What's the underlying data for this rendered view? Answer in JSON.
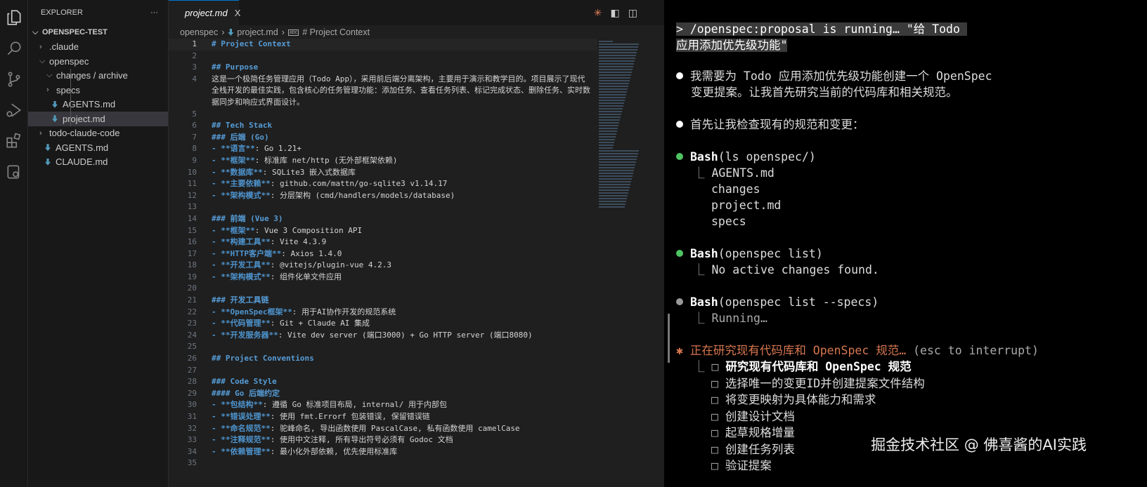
{
  "activity_bar": [
    "explorer-icon",
    "search-icon",
    "source-control-icon",
    "run-debug-icon",
    "extensions-icon",
    "remote-explorer-icon"
  ],
  "sidebar": {
    "title": "EXPLORER",
    "more": "···",
    "root": "OPENSPEC-TEST",
    "items": [
      {
        "label": ".claude",
        "type": "folder",
        "open": false,
        "depth": 1
      },
      {
        "label": "openspec",
        "type": "folder",
        "open": true,
        "depth": 1
      },
      {
        "label": "changes / archive",
        "type": "folder",
        "open": true,
        "depth": 2
      },
      {
        "label": "specs",
        "type": "folder",
        "open": false,
        "depth": 2
      },
      {
        "label": "AGENTS.md",
        "type": "md",
        "depth": 2
      },
      {
        "label": "project.md",
        "type": "md",
        "depth": 2,
        "selected": true
      },
      {
        "label": "todo-claude-code",
        "type": "folder",
        "open": false,
        "depth": 1
      },
      {
        "label": "AGENTS.md",
        "type": "md",
        "depth": 1
      },
      {
        "label": "CLAUDE.md",
        "type": "md",
        "depth": 1
      }
    ]
  },
  "editor": {
    "tab": "project.md",
    "tab_close": "X",
    "breadcrumb": [
      "openspec",
      "project.md",
      "# Project Context"
    ],
    "lines": [
      {
        "n": "1",
        "h": "# Project Context"
      },
      {
        "n": "2"
      },
      {
        "n": "3",
        "h": "## Purpose"
      },
      {
        "n": "4",
        "t": "这是一个极简任务管理应用（Todo App），采用前后端分离架构，主要用于演示和教学目的。项目展示了现代全栈开发的最佳实践，包含核心的任务管理功能：添加任务、查看任务列表、标记完成状态、删除任务、实时数据同步和响应式界面设计。"
      },
      {
        "n": "5"
      },
      {
        "n": "6",
        "h": "## Tech Stack"
      },
      {
        "n": "7",
        "h": "### 后端 (Go)"
      },
      {
        "n": "8",
        "b": "- **语言**",
        "t": ": Go 1.21+"
      },
      {
        "n": "9",
        "b": "- **框架**",
        "t": ": 标准库 net/http (无外部框架依赖)"
      },
      {
        "n": "10",
        "b": "- **数据库**",
        "t": ": SQLite3 嵌入式数据库"
      },
      {
        "n": "11",
        "b": "- **主要依赖**",
        "t": ": github.com/mattn/go-sqlite3 v1.14.17"
      },
      {
        "n": "12",
        "b": "- **架构模式**",
        "t": ": 分层架构 (cmd/handlers/models/database)"
      },
      {
        "n": "13"
      },
      {
        "n": "14",
        "h": "### 前端 (Vue 3)"
      },
      {
        "n": "15",
        "b": "- **框架**",
        "t": ": Vue 3 Composition API"
      },
      {
        "n": "16",
        "b": "- **构建工具**",
        "t": ": Vite 4.3.9"
      },
      {
        "n": "17",
        "b": "- **HTTP客户端**",
        "t": ": Axios 1.4.0"
      },
      {
        "n": "18",
        "b": "- **开发工具**",
        "t": ": @vitejs/plugin-vue 4.2.3"
      },
      {
        "n": "19",
        "b": "- **架构模式**",
        "t": ": 组件化单文件应用"
      },
      {
        "n": "20"
      },
      {
        "n": "21",
        "h": "### 开发工具链"
      },
      {
        "n": "22",
        "b": "- **OpenSpec框架**",
        "t": ": 用于AI协作开发的规范系统"
      },
      {
        "n": "23",
        "b": "- **代码管理**",
        "t": ": Git + Claude AI 集成"
      },
      {
        "n": "24",
        "b": "- **开发服务器**",
        "t": ": Vite dev server (端口3000) + Go HTTP server (端口8080)"
      },
      {
        "n": "25"
      },
      {
        "n": "26",
        "h": "## Project Conventions"
      },
      {
        "n": "27"
      },
      {
        "n": "28",
        "h": "### Code Style"
      },
      {
        "n": "29",
        "h": "#### Go 后端约定"
      },
      {
        "n": "30",
        "b": "- **包结构**",
        "t": ": 遵循 Go 标准项目布局, internal/ 用于内部包"
      },
      {
        "n": "31",
        "b": "- **错误处理**",
        "t": ": 使用 fmt.Errorf 包装错误, 保留错误链"
      },
      {
        "n": "32",
        "b": "- **命名规范**",
        "t": ": 驼峰命名, 导出函数使用 PascalCase, 私有函数使用 camelCase"
      },
      {
        "n": "33",
        "b": "- **注释规范**",
        "t": ": 使用中文注释, 所有导出符号必须有 Godoc 文档"
      },
      {
        "n": "34",
        "b": "- **依赖管理**",
        "t": ": 最小化外部依赖, 优先使用标准库"
      },
      {
        "n": "35"
      }
    ]
  },
  "terminal": {
    "prompt1": "> /openspec:proposal is running… \"给 Todo ",
    "prompt2": "应用添加优先级功能\"",
    "msg1a": "我需要为 Todo 应用添加优先级功能创建一个 OpenSpec",
    "msg1b": "变更提案。让我首先研究当前的代码库和相关规范。",
    "msg2": "首先让我检查现有的规范和变更：",
    "tool1": {
      "name": "Bash",
      "args": "(ls openspec/)",
      "output": [
        "AGENTS.md",
        "changes",
        "project.md",
        "specs"
      ]
    },
    "tool2": {
      "name": "Bash",
      "args": "(openspec list)",
      "output": [
        "No active changes found."
      ]
    },
    "tool3": {
      "name": "Bash",
      "args": "(openspec list --specs)",
      "output": [
        "Running…"
      ]
    },
    "status": "正在研究现有代码库和 OpenSpec 规范…",
    "status_hint": " (esc to interrupt)",
    "todos": [
      "研究现有代码库和 OpenSpec 规范",
      "选择唯一的变更ID并创建提案文件结构",
      "将变更映射为具体能力和需求",
      "创建设计文档",
      "起草规格增量",
      "创建任务列表",
      "验证提案"
    ],
    "watermark": "掘金技术社区 @ 佛喜酱的AI实践"
  },
  "colors": {
    "accent": "#0078d4",
    "success": "#4ec562",
    "running": "#999999",
    "spinner": "#d7764f"
  }
}
